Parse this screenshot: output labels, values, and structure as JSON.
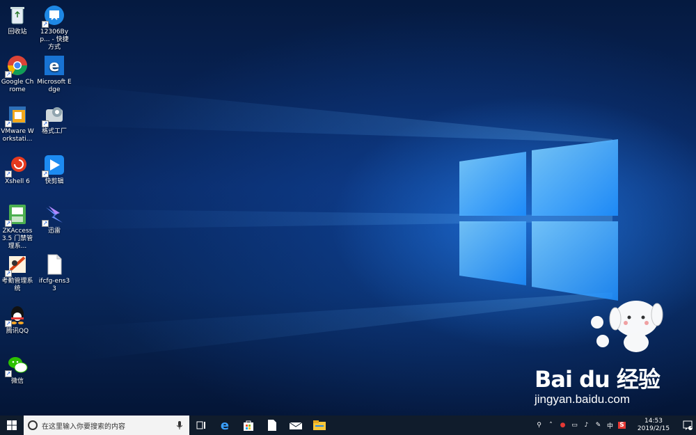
{
  "desktop_icons": [
    {
      "label": "回收站",
      "icon": "recycle-bin-icon"
    },
    {
      "label": "12306Byp... - 快捷方式",
      "icon": "12306bypass-icon"
    },
    {
      "label": "Google Chrome",
      "icon": "chrome-icon"
    },
    {
      "label": "Microsoft Edge",
      "icon": "edge-icon"
    },
    {
      "label": "VMware Workstati...",
      "icon": "vmware-icon"
    },
    {
      "label": "格式工厂",
      "icon": "format-factory-icon"
    },
    {
      "label": "Xshell 6",
      "icon": "xshell-icon"
    },
    {
      "label": "快剪辑",
      "icon": "kuaijianji-icon"
    },
    {
      "label": "ZKAccess3.5 门禁管理系...",
      "icon": "zkaccess-icon"
    },
    {
      "label": "迅雷",
      "icon": "thunder-icon"
    },
    {
      "label": "考勤管理系统",
      "icon": "attendance-icon"
    },
    {
      "label": "ifcfg-ens33",
      "icon": "file-icon"
    },
    {
      "label": "腾讯QQ",
      "icon": "qq-icon"
    },
    {
      "label": "微信",
      "icon": "wechat-icon"
    }
  ],
  "taskbar": {
    "search_placeholder": "在这里输入你要搜索的内容",
    "apps": [
      "task-view-icon",
      "edge-icon",
      "store-icon",
      "file-icon",
      "mail-icon",
      "file-explorer-icon"
    ],
    "tray": {
      "input_method": "中",
      "time": "14:53",
      "date": "2019/2/15",
      "notification_count": "1"
    }
  },
  "watermark": {
    "logo": "Bai du 经验",
    "url": "jingyan.baidu.com"
  },
  "colors": {
    "taskbar": "#101c2c",
    "search_box": "#f3f3f3",
    "accent": "#1a8cff"
  }
}
